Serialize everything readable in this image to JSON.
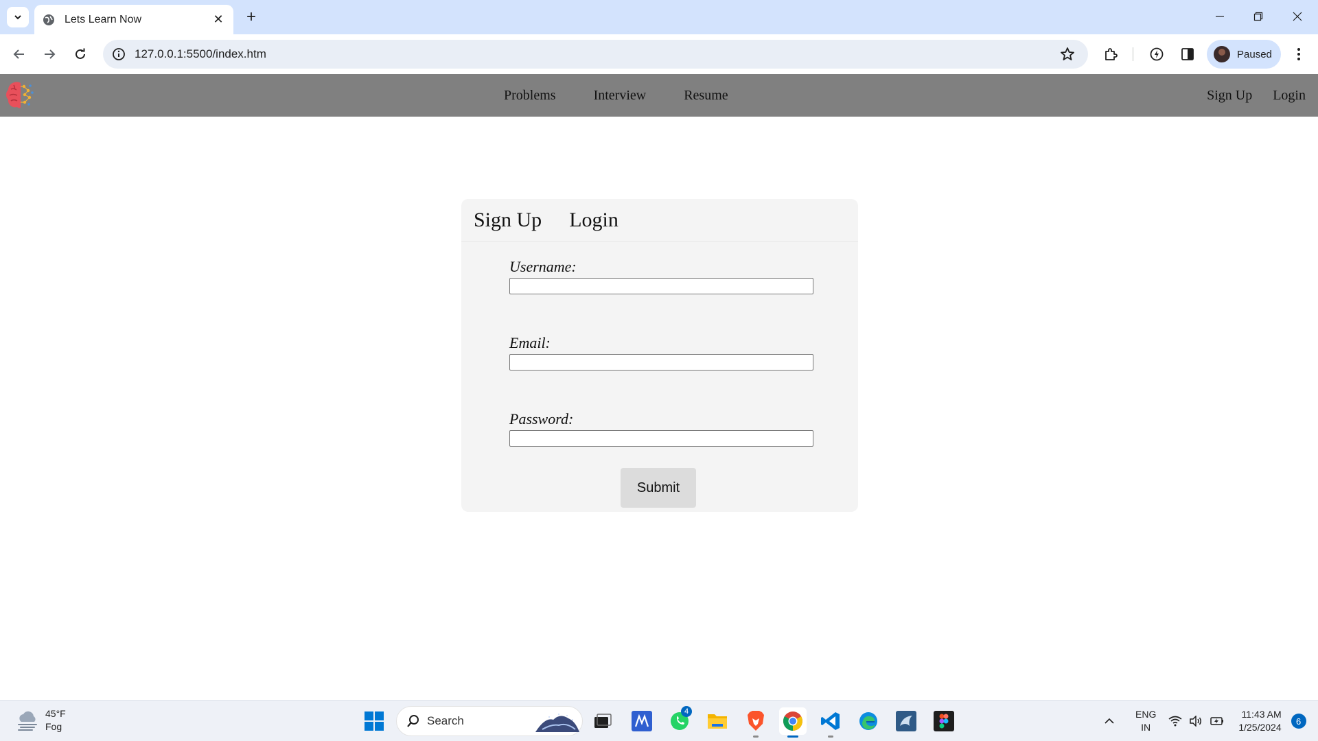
{
  "browser": {
    "tab_title": "Lets Learn Now",
    "url": "127.0.0.1:5500/index.htm",
    "profile_label": "Paused"
  },
  "site": {
    "nav_links": [
      "Problems",
      "Interview",
      "Resume"
    ],
    "auth_links": [
      "Sign Up",
      "Login"
    ]
  },
  "form": {
    "tabs": [
      "Sign Up",
      "Login"
    ],
    "username_label": "Username:",
    "email_label": "Email:",
    "password_label": "Password:",
    "username_value": "",
    "email_value": "",
    "password_value": "",
    "submit_label": "Submit"
  },
  "taskbar": {
    "weather_temp": "45°F",
    "weather_desc": "Fog",
    "search_placeholder": "Search",
    "whatsapp_badge": "4",
    "lang_line1": "ENG",
    "lang_line2": "IN",
    "time": "11:43 AM",
    "date": "1/25/2024",
    "notification_count": "6"
  },
  "colors": {
    "tabstrip": "#d3e3fd",
    "site_nav": "#808080",
    "card_bg": "#f4f4f4",
    "submit_bg": "#dcdcdc",
    "accent": "#0067c0"
  }
}
